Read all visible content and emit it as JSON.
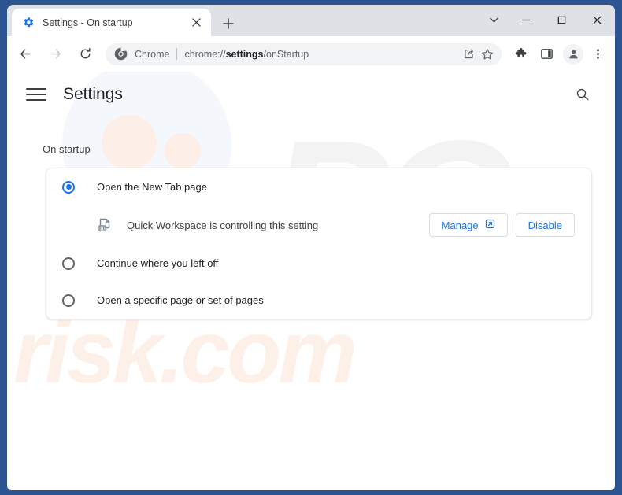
{
  "window": {
    "controls": [
      {
        "name": "tab-search",
        "glyph": "chevron-down"
      },
      {
        "name": "minimize",
        "glyph": "minimize"
      },
      {
        "name": "maximize",
        "glyph": "maximize"
      },
      {
        "name": "close",
        "glyph": "close"
      }
    ],
    "frame_color": "#2b5490"
  },
  "tab": {
    "title": "Settings - On startup",
    "favicon": "settings-gear-icon",
    "close_label": "Close tab",
    "newtab_label": "New tab"
  },
  "toolbar": {
    "back": "Back",
    "forward": "Forward",
    "reload": "Reload",
    "omnibox": {
      "scheme_label": "Chrome",
      "url_prefix": "chrome://",
      "url_bold": "settings",
      "url_suffix": "/onStartup",
      "full_url": "chrome://settings/onStartup",
      "share_label": "Share this page",
      "bookmark_label": "Bookmark this tab"
    },
    "extensions_label": "Extensions",
    "side_panel_label": "Side panel",
    "profile_label": "Profile",
    "menu_label": "Customize and control Google Chrome"
  },
  "settings": {
    "menu_label": "Main menu",
    "title": "Settings",
    "search_label": "Search settings",
    "section_label": "On startup",
    "options": [
      {
        "label": "Open the New Tab page",
        "selected": true
      },
      {
        "label": "Continue where you left off",
        "selected": false
      },
      {
        "label": "Open a specific page or set of pages",
        "selected": false
      }
    ],
    "extension_notice": {
      "icon": "extension-document-icon",
      "text": "Quick Workspace is controlling this setting",
      "manage_label": "Manage",
      "manage_icon": "external-link-icon",
      "disable_label": "Disable"
    },
    "accent_color": "#1a73e8"
  },
  "watermark": {
    "top": "PC",
    "bottom": "risk.com"
  }
}
